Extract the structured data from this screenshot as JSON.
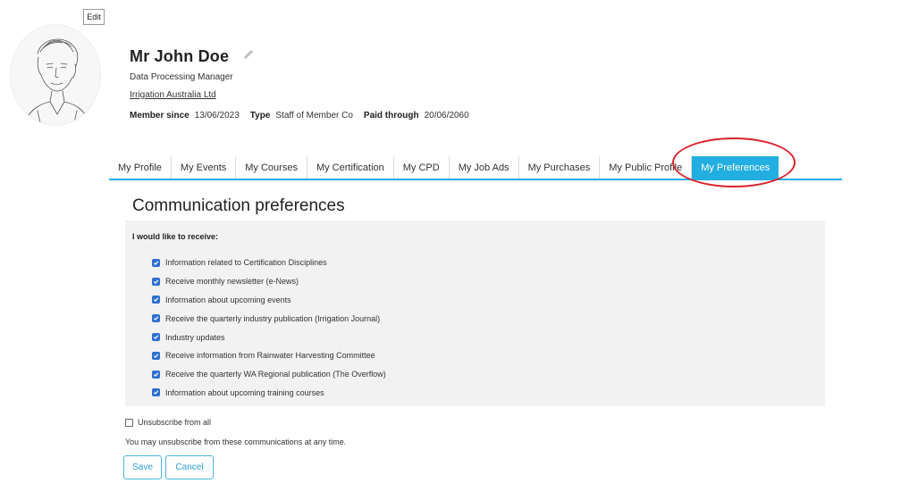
{
  "profile": {
    "edit_label": "Edit",
    "name": "Mr John Doe",
    "job_title": "Data Processing Manager",
    "organisation": "Irrigation Australia Ltd",
    "member_since_label": "Member since",
    "member_since": "13/06/2023",
    "type_label": "Type",
    "type": "Staff of Member Co",
    "paid_through_label": "Paid through",
    "paid_through": "20/06/2060"
  },
  "tabs": [
    {
      "label": "My Profile",
      "active": false
    },
    {
      "label": "My Events",
      "active": false
    },
    {
      "label": "My Courses",
      "active": false
    },
    {
      "label": "My Certification",
      "active": false
    },
    {
      "label": "My CPD",
      "active": false
    },
    {
      "label": "My Job Ads",
      "active": false
    },
    {
      "label": "My Purchases",
      "active": false
    },
    {
      "label": "My Public Profile",
      "active": false
    },
    {
      "label": "My Preferences",
      "active": true
    }
  ],
  "preferences": {
    "title": "Communication preferences",
    "intro": "I would like to receive:",
    "items": [
      {
        "label": "Information related to Certification Disciplines",
        "checked": true
      },
      {
        "label": "Receive monthly newsletter (e-News)",
        "checked": true
      },
      {
        "label": "Information about upcoming events",
        "checked": true
      },
      {
        "label": "Receive the quarterly industry publication (Irrigation Journal)",
        "checked": true
      },
      {
        "label": "Industry updates",
        "checked": true
      },
      {
        "label": "Receive information from Rainwater Harvesting Committee",
        "checked": true
      },
      {
        "label": "Receive the quarterly WA Regional publication (The Overflow)",
        "checked": true
      },
      {
        "label": "Information about upcoming training courses",
        "checked": true
      }
    ],
    "unsubscribe_label": "Unsubscribe from all",
    "unsubscribe_checked": false,
    "note": "You may unsubscribe from these communications at any time.",
    "save_label": "Save",
    "cancel_label": "Cancel"
  },
  "colors": {
    "accent": "#22aee0",
    "checkbox": "#2e6fcf",
    "highlight": "#d9222a"
  }
}
